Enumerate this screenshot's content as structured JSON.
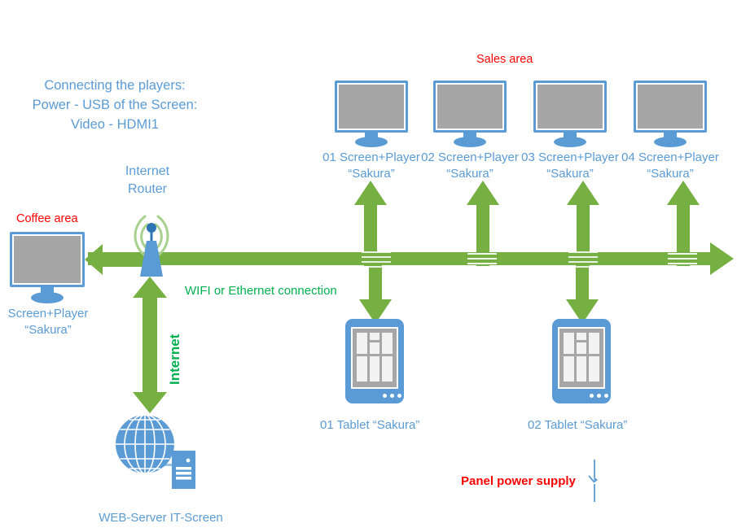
{
  "diagram": {
    "title_note": "Connecting the players:\nPower - USB of the Screen:\nVideo - HDMI1",
    "router_label": "Internet\nRouter",
    "coffee_area_label": "Coffee area",
    "sales_area_label": "Sales area",
    "connection_label": "WIFI or Ethernet connection",
    "internet_label": "Internet",
    "panel_power_label": "Panel power supply",
    "web_server_label": "WEB-Server IT-Screen"
  },
  "colors": {
    "blue": "#5b9bd5",
    "green": "#76b043",
    "green_text": "#00b050",
    "red": "#ff0000",
    "screen_gray": "#a6a6a6",
    "dark_blue": "#2e75b6"
  },
  "coffee_screen": {
    "label_line1": "Screen+Player",
    "label_line2": "“Sakura”"
  },
  "sales_screens": [
    {
      "label_line1": "01 Screen+Player",
      "label_line2": "“Sakura”"
    },
    {
      "label_line1": "02 Screen+Player",
      "label_line2": "“Sakura”"
    },
    {
      "label_line1": "03 Screen+Player",
      "label_line2": "“Sakura”"
    },
    {
      "label_line1": "04 Screen+Player",
      "label_line2": "“Sakura”"
    }
  ],
  "tablets": [
    {
      "label": "01 Tablet “Sakura”"
    },
    {
      "label": "02 Tablet “Sakura”"
    }
  ]
}
